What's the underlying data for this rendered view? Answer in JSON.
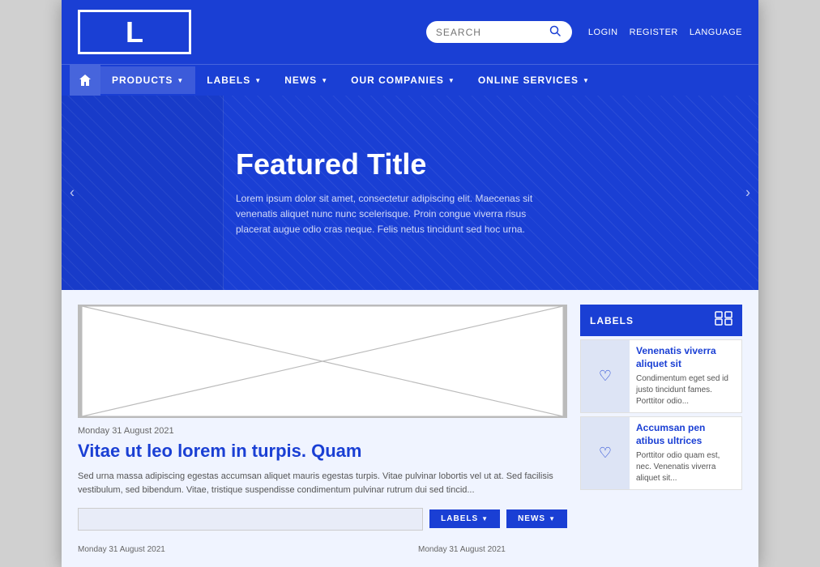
{
  "site": {
    "logo_letter": "L"
  },
  "header": {
    "search_placeholder": "SEARCH",
    "links": {
      "login": "LOGIN",
      "register": "REGISTER",
      "language": "LANGUAGE"
    }
  },
  "nav": {
    "home_icon": "⌂",
    "items": [
      {
        "label": "PRODUCTS",
        "has_arrow": true,
        "active": true
      },
      {
        "label": "LABELS",
        "has_arrow": true,
        "active": false
      },
      {
        "label": "NEWS",
        "has_arrow": true,
        "active": false
      },
      {
        "label": "OUR COMPANIES",
        "has_arrow": true,
        "active": false
      },
      {
        "label": "ONLINE SERVICES",
        "has_arrow": true,
        "active": false
      }
    ]
  },
  "hero": {
    "title": "Featured Title",
    "text": "Lorem ipsum dolor sit amet, consectetur adipiscing elit. Maecenas sit venenatis aliquet nunc nunc scelerisque. Proin congue viverra risus placerat augue odio cras neque. Felis netus tincidunt sed hoc urna.",
    "prev_label": "‹",
    "next_label": "›"
  },
  "article": {
    "date": "Monday 31 August 2021",
    "title": "Vitae ut leo lorem in turpis. Quam",
    "body": "Sed urna massa adipiscing egestas accumsan aliquet mauris egestas turpis. Vitae pulvinar lobortis vel ut at. Sed facilisis vestibulum, sed bibendum. Vitae, tristique suspendisse condimentum pulvinar rutrum dui sed tincid...",
    "labels_btn": "LABELS",
    "news_btn": "NEWS"
  },
  "sidebar": {
    "header_label": "LABELS",
    "items": [
      {
        "title": "Venenatis viverra aliquet sit",
        "text": "Condimentum eget sed id justo tincidunt fames. Porttitor odio..."
      },
      {
        "title": "Accumsan pen atibus ultrices",
        "text": "Porttitor odio quam est, nec. Venenatis viverra aliquet sit..."
      }
    ]
  },
  "bottom_cards": [
    {
      "date": "Monday 31 August 2021"
    },
    {
      "date": "Monday 31 August 2021"
    }
  ]
}
